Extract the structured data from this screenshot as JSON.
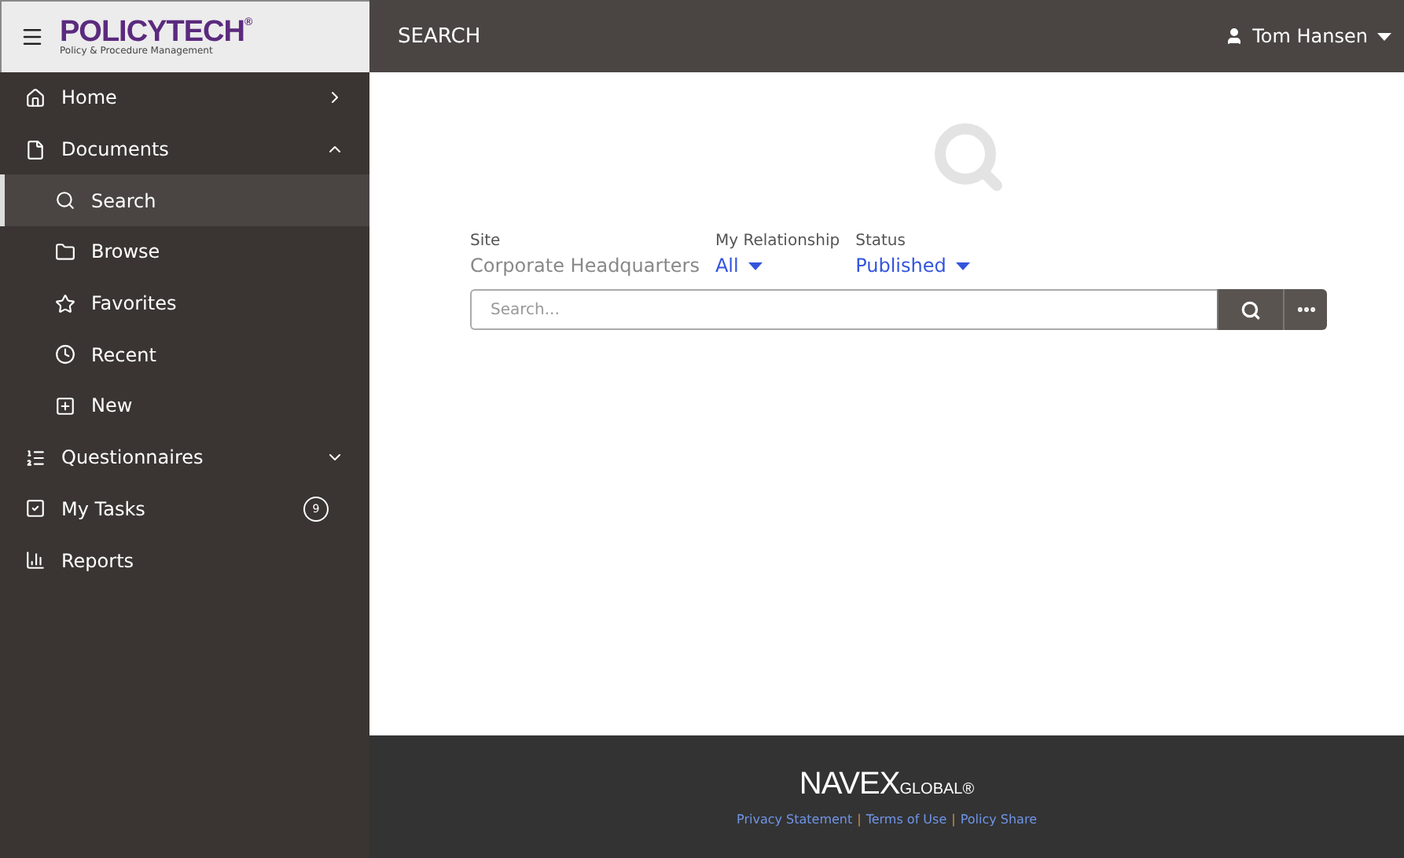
{
  "brand": {
    "name": "POLICYTECH",
    "mark": "®",
    "tagline": "Policy & Procedure Management"
  },
  "header": {
    "title": "SEARCH",
    "user": "Tom Hansen"
  },
  "nav": [
    {
      "label": "Home",
      "kind": "link",
      "selected": false
    },
    {
      "label": "Documents",
      "kind": "group",
      "selected": false,
      "expanded": true,
      "children": [
        {
          "label": "Search",
          "selected": true
        },
        {
          "label": "Browse",
          "selected": false
        },
        {
          "label": "Favorites",
          "selected": false
        },
        {
          "label": "Recent",
          "selected": false
        },
        {
          "label": "New",
          "selected": false
        }
      ]
    },
    {
      "label": "Questionnaires",
      "kind": "group",
      "selected": false,
      "expanded": false
    },
    {
      "label": "My Tasks",
      "kind": "plain",
      "selected": false,
      "badge": "9"
    },
    {
      "label": "Reports",
      "kind": "plain",
      "selected": false
    }
  ],
  "filters": [
    {
      "label": "Site",
      "value": "Corporate Headquarters",
      "dropdown": false
    },
    {
      "label": "My Relationship",
      "value": "All",
      "dropdown": true
    },
    {
      "label": "Status",
      "value": "Published",
      "dropdown": true
    }
  ],
  "search": {
    "placeholder": "Search..."
  },
  "footer": {
    "logo": "NAVEX",
    "logo_suffix": "GLOBAL",
    "mark": "®",
    "separator": "|",
    "links": [
      "Privacy Statement",
      "Terms of Use",
      "Policy Share"
    ]
  }
}
